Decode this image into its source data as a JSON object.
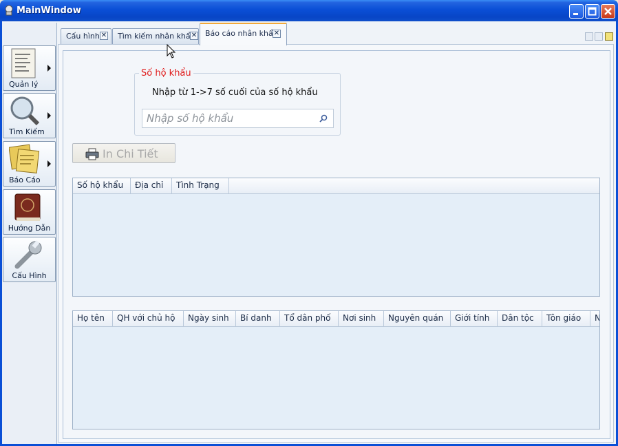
{
  "window": {
    "title": "MainWindow"
  },
  "sidebar": {
    "items": [
      {
        "label": "Quản lý",
        "icon": "document-icon",
        "has_arrow": true
      },
      {
        "label": "Tìm Kiếm",
        "icon": "magnifier-icon",
        "has_arrow": true
      },
      {
        "label": "Báo Cáo",
        "icon": "notes-icon",
        "has_arrow": true
      },
      {
        "label": "Hướng Dẫn",
        "icon": "book-icon",
        "has_arrow": false
      },
      {
        "label": "Cấu Hình",
        "icon": "wrench-icon",
        "has_arrow": false
      }
    ]
  },
  "tabs": [
    {
      "label": "Cấu hình",
      "active": false
    },
    {
      "label": "Tìm kiếm nhân khẩu",
      "active": false
    },
    {
      "label": "Báo cáo nhân khẩu",
      "active": true
    }
  ],
  "household": {
    "group_title": "Số hộ khẩu",
    "hint": "Nhập từ 1->7 số cuối của số hộ khẩu",
    "search_placeholder": "Nhập số hộ khẩu"
  },
  "print_button": {
    "label": "In Chi Tiết",
    "enabled": false
  },
  "household_table": {
    "columns": [
      "Số hộ khẩu",
      "Địa chỉ",
      "Tình Trạng"
    ],
    "rows": []
  },
  "members_table": {
    "columns": [
      "Họ tên",
      "QH với chủ hộ",
      "Ngày sinh",
      "Bí danh",
      "Tổ dân phố",
      "Nơi sinh",
      "Nguyên quán",
      "Giới tính",
      "Dân tộc",
      "Tôn giáo",
      "N"
    ],
    "rows": []
  },
  "colors": {
    "titlebar": "#0A4FD6",
    "group_title": "#E01B1B",
    "active_tab_accent": "#F2A93A"
  }
}
